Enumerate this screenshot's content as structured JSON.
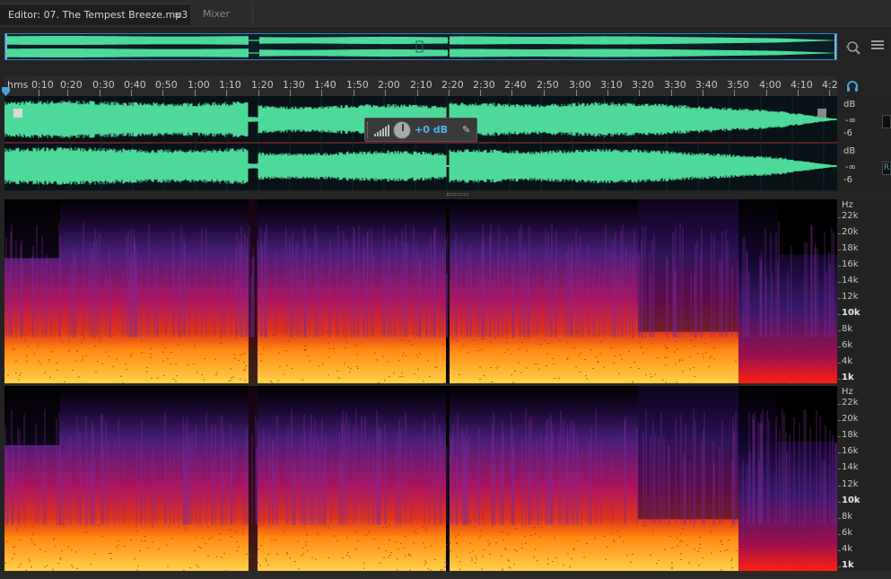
{
  "tabs": {
    "editor_label": "Editor: 07. The Tempest Breeze.mp3",
    "menu_glyph": "≡",
    "mixer_label": "Mixer"
  },
  "ruler": {
    "unit": "hms",
    "labels": [
      "0:10",
      "0:20",
      "0:30",
      "0:40",
      "0:50",
      "1:00",
      "1:10",
      "1:20",
      "1:30",
      "1:40",
      "1:50",
      "2:00",
      "2:10",
      "2:20",
      "2:30",
      "2:40",
      "2:50",
      "3:00",
      "3:10",
      "3:20",
      "3:30",
      "3:40",
      "3:50",
      "4:00",
      "4:10",
      "4:2"
    ]
  },
  "amplitude_scale": {
    "channel1": [
      "dB",
      "-∞",
      "-6"
    ],
    "channel2": [
      "dB",
      "-∞",
      "-6"
    ]
  },
  "hud": {
    "gain": "+0 dB"
  },
  "side_boxes": [
    "",
    "R"
  ],
  "spectral_scale": {
    "unit": "Hz",
    "labels": [
      "22k",
      "20k",
      "18k",
      "16k",
      "14k",
      "12k",
      "10k",
      "8k",
      "6k",
      "4k",
      "1k"
    ],
    "bold": [
      "10k",
      "1k"
    ]
  },
  "colors": {
    "waveform": "#4dd99a",
    "accent_blue": "#2e86b9",
    "hud_value": "#4fb2ea",
    "background": "#232323"
  },
  "icons": {
    "zoom": "magnifier-zoom-icon",
    "list": "list-icon",
    "headphones": "headphones-icon",
    "pin": "pin-icon",
    "playhead": "playhead-marker-icon"
  }
}
